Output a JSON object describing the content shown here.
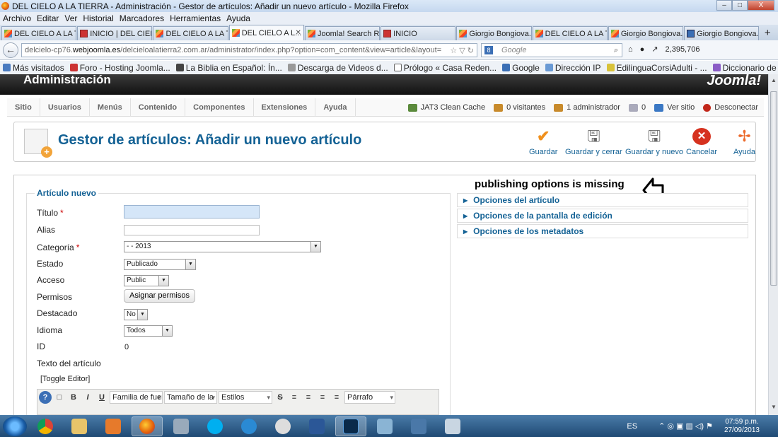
{
  "window": {
    "title": "DEL CIELO A LA TIERRA - Administración - Gestor de artículos: Añadir un nuevo artículo - Mozilla Firefox",
    "controls": [
      "–",
      "□",
      "X"
    ]
  },
  "menubar": [
    "Archivo",
    "Editar",
    "Ver",
    "Historial",
    "Marcadores",
    "Herramientas",
    "Ayuda"
  ],
  "tabs": [
    {
      "label": "DEL CIELO A LA TI...",
      "icon": "joomla"
    },
    {
      "label": "INICIO | DEL CIEL...",
      "icon": "page"
    },
    {
      "label": "DEL CIELO A LA TI...",
      "icon": "joomla"
    },
    {
      "label": "DEL CIELO A L...",
      "icon": "joomla",
      "active": true
    },
    {
      "label": "Joomla! Search Re...",
      "icon": "joomla"
    },
    {
      "label": "INICIO",
      "icon": "page"
    },
    {
      "label": "Giorgio Bongiova...",
      "icon": "joomla"
    },
    {
      "label": "DEL CIELO A LA TI...",
      "icon": "joomla"
    },
    {
      "label": "Giorgio Bongiova...",
      "icon": "joomla"
    },
    {
      "label": "Giorgio Bongiova...",
      "icon": "page"
    }
  ],
  "navbar": {
    "url_prefix": "delcielo-cp76.",
    "url_domain": "webjoomla.es",
    "url_rest": "/delcieloalatierra2.com.ar/administrator/index.php?option=com_content&view=article&layout=",
    "search_placeholder": "Google",
    "counter": "2,395,706"
  },
  "bookmarks": [
    "Más visitados",
    "Foro - Hosting Joomla...",
    "La Biblia en Español: Ín...",
    "Descarga de Videos d...",
    "Prólogo « Casa Reden...",
    "Google",
    "Dirección IP",
    "EdilinguaCorsiAdulti - ...",
    "Diccionario de la leng..."
  ],
  "joomla": {
    "header_title": "Administración",
    "logo_text": "Joomla!",
    "menu": [
      "Sitio",
      "Usuarios",
      "Menús",
      "Contenido",
      "Componentes",
      "Extensiones",
      "Ayuda"
    ],
    "status": {
      "cache": "JAT3 Clean Cache",
      "visitors": "0 visitantes",
      "admins": "1 administrador",
      "messages": "0",
      "view_site": "Ver sitio",
      "logout": "Desconectar"
    },
    "page_title": "Gestor de artículos: Añadir un nuevo artículo",
    "toolbar": {
      "save": "Guardar",
      "save_close": "Guardar y cerrar",
      "save_new": "Guardar y nuevo",
      "cancel": "Cancelar",
      "help": "Ayuda"
    }
  },
  "form": {
    "legend": "Artículo nuevo",
    "title_label": "Título",
    "alias_label": "Alias",
    "category_label": "Categoría",
    "category_value": "- - 2013",
    "state_label": "Estado",
    "state_value": "Publicado",
    "access_label": "Acceso",
    "access_value": "Public",
    "permissions_label": "Permisos",
    "permissions_button": "Asignar permisos",
    "featured_label": "Destacado",
    "featured_value": "No",
    "language_label": "Idioma",
    "language_value": "Todos",
    "id_label": "ID",
    "id_value": "0",
    "text_label": "Texto del artículo",
    "toggle_editor": "[Toggle Editor]",
    "required_mark": "*"
  },
  "editor": {
    "font_family": "Familia de fuer",
    "font_size": "Tamaño de la",
    "styles": "Estilos",
    "format": "Párrafo"
  },
  "right_panel": {
    "annotation": "publishing options is missing",
    "accordions": [
      "Opciones del artículo",
      "Opciones de la pantalla de edición",
      "Opciones de los metadatos"
    ]
  },
  "taskbar": {
    "lang": "ES",
    "time": "07:59 p.m.",
    "date": "27/09/2013"
  }
}
